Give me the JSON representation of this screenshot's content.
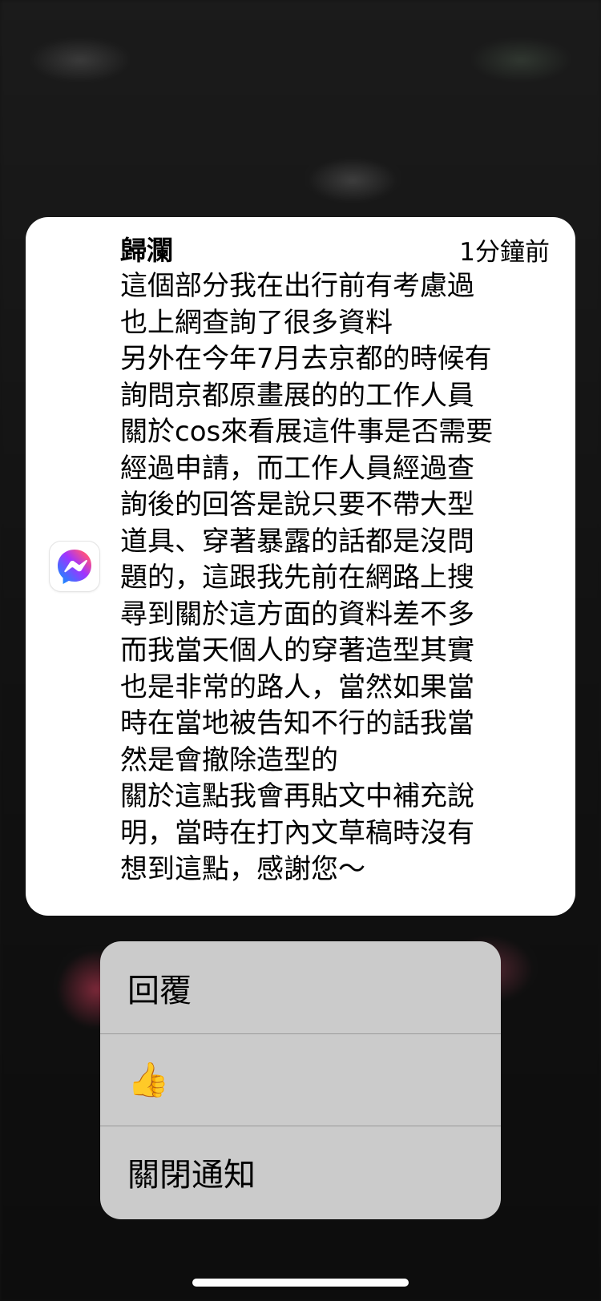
{
  "notification": {
    "sender": "歸瀾",
    "time": "1分鐘前",
    "app_icon": "messenger-icon",
    "message_lines": [
      "這個部分我在出行前有考慮過",
      "也上網查詢了很多資料",
      "另外在今年7月去京都的時候有",
      "詢問京都原畫展的的工作人員",
      "關於cos來看展這件事是否需要",
      "經過申請，而工作人員經過查",
      "詢後的回答是說只要不帶大型",
      "道具、穿著暴露的話都是沒問",
      "題的，這跟我先前在網路上搜",
      "尋到關於這方面的資料差不多",
      "而我當天個人的穿著造型其實",
      "也是非常的路人，當然如果當",
      "時在當地被告知不行的話我當",
      "然是會撤除造型的",
      "關於這點我會再貼文中補充說",
      "明，當時在打內文草稿時沒有",
      "想到這點，感謝您～"
    ]
  },
  "actions": {
    "reply": "回覆",
    "like_icon": "thumbs-up-icon",
    "like_glyph": "👍",
    "mute": "關閉通知"
  },
  "colors": {
    "card": "#ffffff",
    "menu": "#cbcbcb",
    "messenger_gradient": [
      "#0099ff",
      "#a033ff",
      "#ff5280",
      "#ff7061"
    ]
  }
}
